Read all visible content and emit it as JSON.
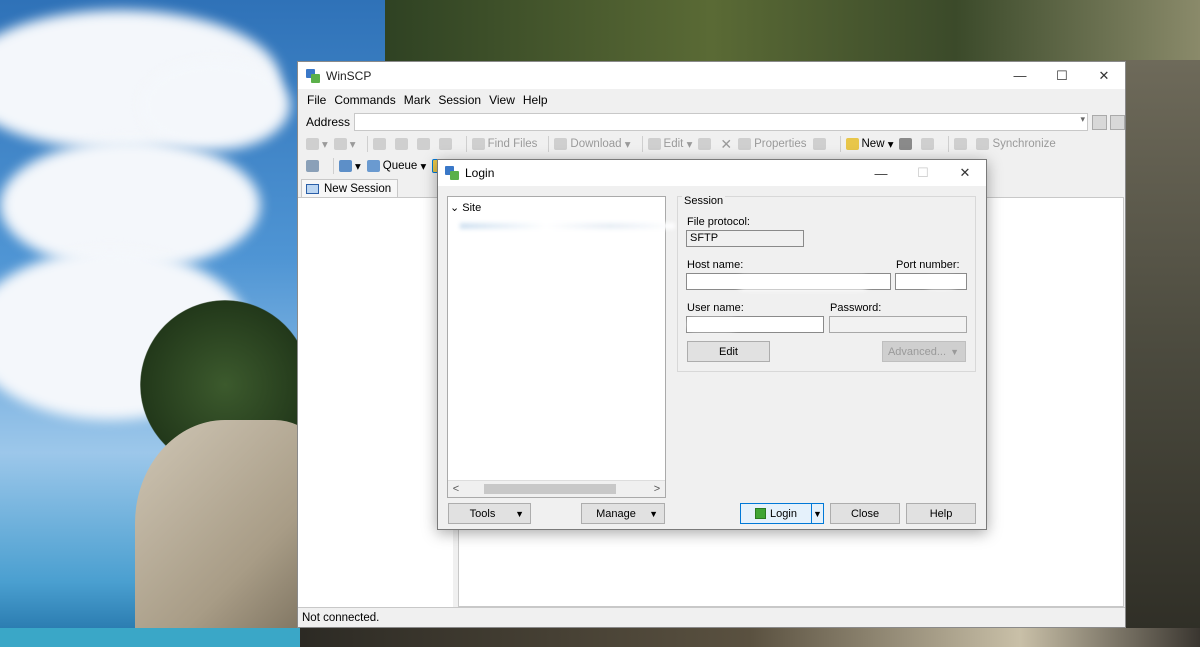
{
  "main_window": {
    "title": "WinSCP",
    "controls": {
      "minimize": "—",
      "maximize": "☐",
      "close": "✕"
    },
    "menu": [
      "File",
      "Commands",
      "Mark",
      "Session",
      "View",
      "Help"
    ],
    "address_label": "Address",
    "toolbar": {
      "find_files": "Find Files",
      "download": "Download",
      "edit": "Edit",
      "properties": "Properties",
      "new": "New",
      "synchronize": "Synchronize"
    },
    "queue_label": "Queue",
    "tab_new_session": "New Session",
    "status": "Not connected."
  },
  "login": {
    "title": "Login",
    "controls": {
      "minimize": "—",
      "maximize": "☐",
      "close": "✕"
    },
    "tree": {
      "root": "Site"
    },
    "session_group": "Session",
    "file_protocol_label": "File protocol:",
    "file_protocol_value": "SFTP",
    "host_name_label": "Host name:",
    "port_number_label": "Port number:",
    "user_name_label": "User name:",
    "password_label": "Password:",
    "edit_button": "Edit",
    "advanced_button": "Advanced...",
    "tools_button": "Tools",
    "manage_button": "Manage",
    "login_button": "Login",
    "close_button": "Close",
    "help_button": "Help"
  },
  "icons": [
    "app-icon",
    "back-arrow-icon",
    "forward-arrow-icon",
    "folder-icon",
    "home-icon",
    "refresh-icon",
    "find-icon",
    "download-icon",
    "edit-icon",
    "delete-icon",
    "properties-icon",
    "new-icon",
    "terminal-icon",
    "synchronize-icon",
    "gear-icon",
    "queue-icon",
    "monitor-icon",
    "login-icon",
    "dropdown-icon"
  ]
}
